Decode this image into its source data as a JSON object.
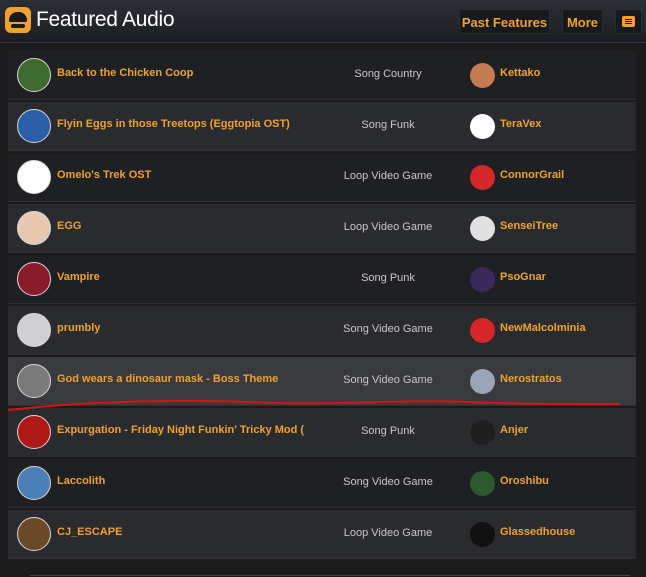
{
  "header": {
    "title": "Featured Audio",
    "past_features": "Past Features",
    "more": "More",
    "accent": "#f0a22e"
  },
  "rows": [
    {
      "title": "Back to the Chicken Coop",
      "type": "Song Country",
      "author": "Kettako",
      "thumb_icon": "chicken-art-icon",
      "thumb_bg": "#3d6a2e",
      "avatar_bg": "#c77b50",
      "highlighted": false
    },
    {
      "title": "Flyin Eggs in those Treetops (Eggtopia OST)",
      "type": "Song Funk",
      "author": "TeraVex",
      "thumb_icon": "eggtopia-art-icon",
      "thumb_bg": "#2b5ea8",
      "avatar_bg": "#ffffff",
      "highlighted": false
    },
    {
      "title": "Omelo's Trek OST",
      "type": "Loop Video Game",
      "author": "ConnorGrail",
      "thumb_icon": "pixel-art-icon",
      "thumb_bg": "#ffffff",
      "avatar_bg": "#d62828",
      "highlighted": false
    },
    {
      "title": "EGG",
      "type": "Loop Video Game",
      "author": "SenseiTree",
      "thumb_icon": "anime-girl-art-icon",
      "thumb_bg": "#e8c9b0",
      "avatar_bg": "#e0e0e0",
      "highlighted": false
    },
    {
      "title": "Vampire",
      "type": "Song Punk",
      "author": "PsoGnar",
      "thumb_icon": "vampire-art-icon",
      "thumb_bg": "#8a1c2a",
      "avatar_bg": "#3a2a5c",
      "highlighted": false
    },
    {
      "title": "prumbly",
      "type": "Song Video Game",
      "author": "NewMalcolminia",
      "thumb_icon": "cd-icon",
      "thumb_bg": "#cfcfd4",
      "avatar_bg": "#d62828",
      "highlighted": false
    },
    {
      "title": "God wears a dinosaur mask - Boss Theme",
      "type": "Song Video Game",
      "author": "Nerostratos",
      "thumb_icon": "dinosaur-mask-art-icon",
      "thumb_bg": "#7a7a7a",
      "avatar_bg": "#9aa4b8",
      "highlighted": true
    },
    {
      "title": "Expurgation - Friday Night Funkin' Tricky Mod (",
      "type": "Song Punk",
      "author": "Anjer",
      "thumb_icon": "tricky-art-icon",
      "thumb_bg": "#b01818",
      "avatar_bg": "#1f1f1f",
      "highlighted": false
    },
    {
      "title": "Laccolith",
      "type": "Song Video Game",
      "author": "Oroshibu",
      "thumb_icon": "laccolith-art-icon",
      "thumb_bg": "#4a7fb8",
      "avatar_bg": "#2b5a2b",
      "highlighted": false
    },
    {
      "title": "CJ_ESCAPE",
      "type": "Loop Video Game",
      "author": "Glassedhouse",
      "thumb_icon": "character-art-icon",
      "thumb_bg": "#6b4a2a",
      "avatar_bg": "#111111",
      "highlighted": false
    }
  ],
  "annotation": {
    "color": "#d61414"
  }
}
